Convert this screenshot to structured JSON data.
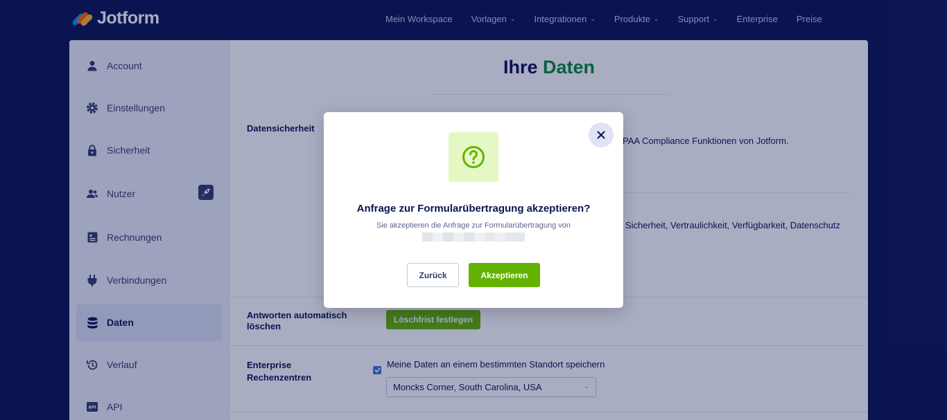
{
  "brand": {
    "name": "Jotform",
    "colors": {
      "navy": "#0a1551",
      "green": "#64b200",
      "dark_green": "#0a8a37"
    }
  },
  "nav": [
    {
      "label": "Mein Workspace",
      "dropdown": false
    },
    {
      "label": "Vorlagen",
      "dropdown": true
    },
    {
      "label": "Integrationen",
      "dropdown": true
    },
    {
      "label": "Produkte",
      "dropdown": true
    },
    {
      "label": "Support",
      "dropdown": true
    },
    {
      "label": "Enterprise",
      "dropdown": false
    },
    {
      "label": "Preise",
      "dropdown": false
    }
  ],
  "sidebar": {
    "items": [
      {
        "label": "Account",
        "icon": "user-icon"
      },
      {
        "label": "Einstellungen",
        "icon": "gear-icon"
      },
      {
        "label": "Sicherheit",
        "icon": "lock-icon"
      },
      {
        "label": "Nutzer",
        "icon": "users-icon",
        "badge": "rocket-icon"
      },
      {
        "label": "Rechnungen",
        "icon": "invoice-icon"
      },
      {
        "label": "Verbindungen",
        "icon": "plug-icon"
      },
      {
        "label": "Daten",
        "icon": "database-icon",
        "active": true
      },
      {
        "label": "Verlauf",
        "icon": "history-icon"
      },
      {
        "label": "API",
        "icon": "api-icon"
      }
    ]
  },
  "main": {
    "title_part1": "Ihre",
    "title_part2": "Daten",
    "rows": {
      "data_security": {
        "label": "Datensicherheit",
        "text_partial": "PAA Compliance Funktionen von Jotform."
      },
      "row2": {
        "text_partial": "Sicherheit, Vertraulichkeit, Verfügbarkeit, Datenschutz"
      },
      "auto_delete": {
        "label_line1": "Antworten automatisch",
        "label_line2": "löschen",
        "button_label": "Löschfrist festlegen"
      },
      "enterprise": {
        "label_line1": "Enterprise",
        "label_line2": "Rechenzentren",
        "checkbox_label": "Meine Daten an einem bestimmten Standort speichern",
        "checked": true,
        "location_value": "Moncks Corner, South Carolina, USA"
      }
    }
  },
  "modal": {
    "icon": "question-icon",
    "title": "Anfrage zur Formularübertragung akzeptieren?",
    "description": "Sie akzeptieren die Anfrage zur Formularübertragung von",
    "back_label": "Zurück",
    "accept_label": "Akzeptieren"
  }
}
